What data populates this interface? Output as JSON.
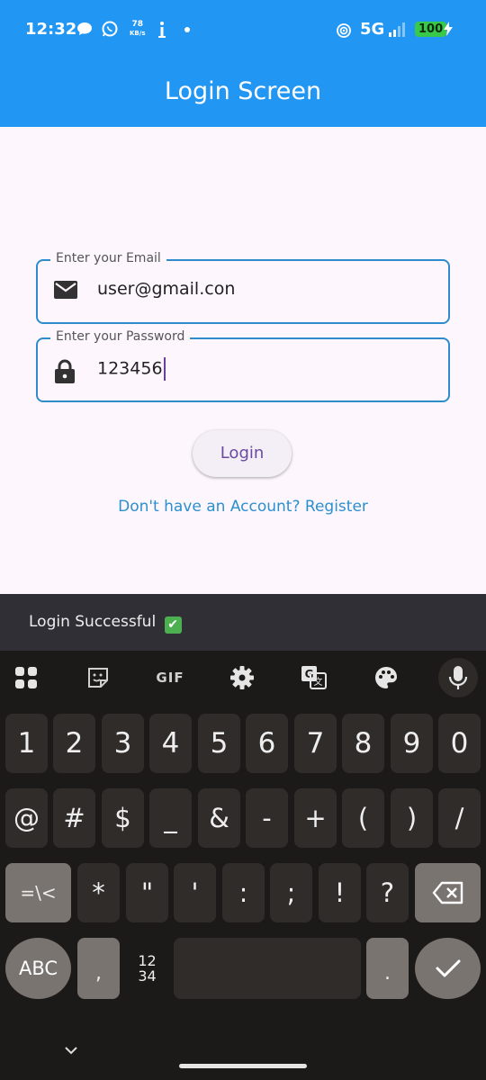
{
  "status_bar": {
    "time": "12:32",
    "speed_value": "78",
    "speed_unit": "KB/s",
    "network": "5G",
    "battery": "100"
  },
  "app_bar": {
    "title": "Login Screen"
  },
  "form": {
    "email": {
      "label": "Enter your Email",
      "value": "user@gmail.con",
      "icon": "mail-icon"
    },
    "password": {
      "label": "Enter your Password",
      "value": "123456",
      "icon": "lock-icon"
    },
    "login_label": "Login",
    "register_text": "Don't have an Account? Register"
  },
  "snackbar": {
    "text": "Login Successful",
    "emoji": "✔"
  },
  "keyboard": {
    "toolbar": {
      "gif_label": "GIF",
      "icons": [
        "apps-grid-icon",
        "sticker-icon",
        "gif-icon",
        "settings-icon",
        "translate-icon",
        "palette-icon",
        "mic-icon"
      ]
    },
    "row_numbers": [
      "1",
      "2",
      "3",
      "4",
      "5",
      "6",
      "7",
      "8",
      "9",
      "0"
    ],
    "row_symbols": [
      "@",
      "#",
      "$",
      "_",
      "&",
      "-",
      "+",
      "(",
      ")",
      "/"
    ],
    "row_third": {
      "toggle": "=\\<",
      "keys": [
        "*",
        "\"",
        "'",
        ":",
        ";",
        "!",
        "?"
      ]
    },
    "row_bottom": {
      "abc": "ABC",
      "comma": ",",
      "numpad_top": "12",
      "numpad_bottom": "34",
      "period": "."
    }
  }
}
